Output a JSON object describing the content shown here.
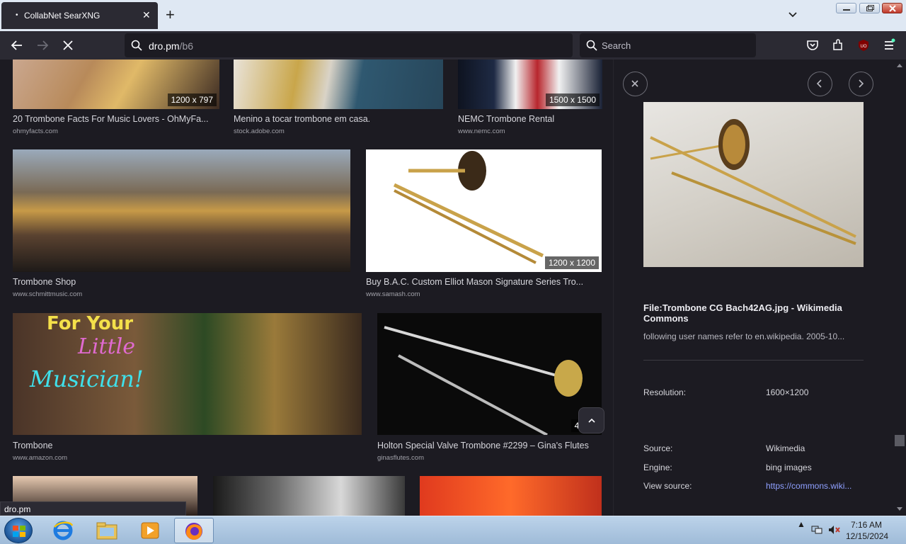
{
  "browser": {
    "tab_title": "CollabNet SearXNG",
    "url_domain": "dro.pm",
    "url_path": "/b6",
    "search_placeholder": "Search",
    "status_text": "dro.pm"
  },
  "results": [
    {
      "title": "20 Trombone Facts For Music Lovers - OhMyFa...",
      "source": "ohmyfacts.com",
      "resolution": "1200 x 797"
    },
    {
      "title": "Menino a tocar trombone em casa.",
      "source": "stock.adobe.com",
      "resolution": ""
    },
    {
      "title": "NEMC Trombone Rental",
      "source": "www.nemc.com",
      "resolution": "1500 x 1500"
    },
    {
      "title": "Trombone Shop",
      "source": "www.schmittmusic.com",
      "resolution": ""
    },
    {
      "title": "Buy B.A.C. Custom Elliot Mason Signature Series Tro...",
      "source": "www.samash.com",
      "resolution": "1200 x 1200"
    },
    {
      "title": "Trombone",
      "source": "www.amazon.com",
      "resolution": "",
      "overlay_lines": [
        "For Your",
        "Little",
        "Musician!"
      ]
    },
    {
      "title": "Holton Special Valve Trombone #2299 – Gina's Flutes",
      "source": "ginasflutes.com",
      "resolution": "480 x"
    }
  ],
  "detail": {
    "title": "File:Trombone CG Bach42AG.jpg - Wikimedia Commons",
    "description": "following user names refer to en.wikipedia. 2005-10...",
    "resolution_label": "Resolution:",
    "resolution_value": "1600×1200",
    "source_label": "Source:",
    "source_value": "Wikimedia",
    "engine_label": "Engine:",
    "engine_value": "bing images",
    "view_source_label": "View source:",
    "view_source_value": "https://commons.wiki..."
  },
  "taskbar": {
    "time": "7:16 AM",
    "date": "12/15/2024"
  },
  "colors": {
    "page_bg": "#1c1b22",
    "toolbar_bg": "#2b2a33",
    "link": "#8fa0ff"
  }
}
